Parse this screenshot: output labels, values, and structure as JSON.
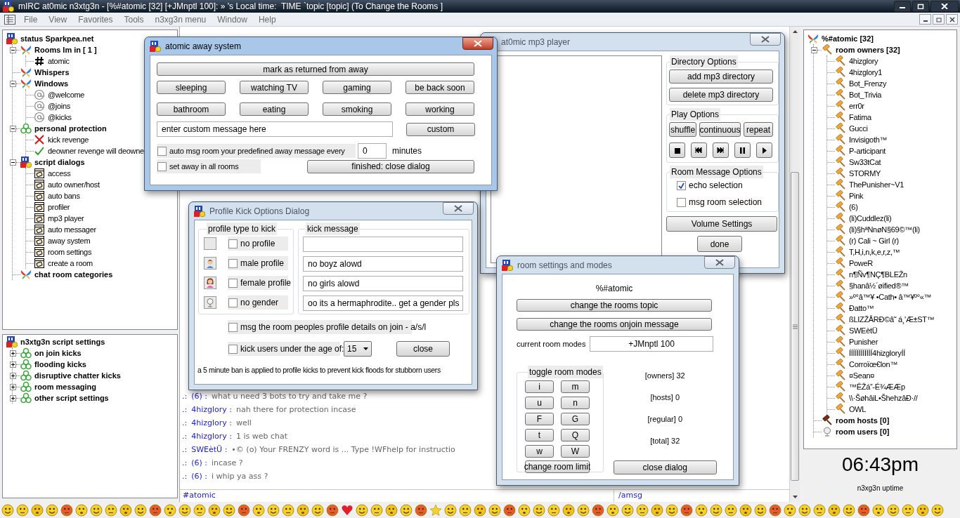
{
  "window": {
    "title": "mIRC at0mic n3xtg3n - [%#atomic [32] [+JMnptl 100]: » 's Local time:  TIME `topic [topic] (To Change the Rooms ]",
    "menu": [
      "File",
      "View",
      "Favorites",
      "Tools",
      "n3xg3n menu",
      "Window",
      "Help"
    ]
  },
  "server_tree": {
    "label": "status Sparkpea.net",
    "kind": "server",
    "children": [
      {
        "label": "Rooms Im in [ 1 ]",
        "kind": "butterfly",
        "expanded": true,
        "children": [
          {
            "label": "atomic",
            "kind": "channel"
          }
        ]
      },
      {
        "label": "Whispers",
        "kind": "butterfly"
      },
      {
        "label": "Windows",
        "kind": "butterfly",
        "expanded": true,
        "children": [
          {
            "label": "@welcome",
            "kind": "query"
          },
          {
            "label": "@joins",
            "kind": "query"
          },
          {
            "label": "@kicks",
            "kind": "query"
          }
        ]
      },
      {
        "label": "personal protection",
        "kind": "biohazard",
        "expanded": true,
        "children": [
          {
            "label": "kick revenge",
            "kind": "toggle",
            "enabled": false
          },
          {
            "label": "deowner revenge will deowne",
            "kind": "toggle",
            "enabled": true
          }
        ]
      },
      {
        "label": "script dialogs",
        "kind": "server",
        "expanded": true,
        "children": [
          {
            "label": "access",
            "kind": "dialog"
          },
          {
            "label": "auto owner/host",
            "kind": "dialog"
          },
          {
            "label": "auto bans",
            "kind": "dialog"
          },
          {
            "label": "profiler",
            "kind": "dialog"
          },
          {
            "label": "mp3 player",
            "kind": "dialog"
          },
          {
            "label": "auto messager",
            "kind": "dialog"
          },
          {
            "label": "away system",
            "kind": "dialog"
          },
          {
            "label": "room settings",
            "kind": "dialog"
          },
          {
            "label": "create a room",
            "kind": "dialog"
          }
        ]
      },
      {
        "label": "chat room categories",
        "kind": "butterfly"
      }
    ]
  },
  "settings_tree": {
    "label": "n3xtg3n script settings",
    "kind": "server",
    "children": [
      {
        "label": "on join kicks",
        "kind": "biohazard",
        "expanded": false
      },
      {
        "label": "flooding kicks",
        "kind": "biohazard",
        "expanded": false
      },
      {
        "label": "disruptive chatter kicks",
        "kind": "biohazard",
        "expanded": false
      },
      {
        "label": "room messaging",
        "kind": "biohazard",
        "expanded": false
      },
      {
        "label": "other script settings",
        "kind": "biohazard",
        "expanded": false
      }
    ]
  },
  "chat": {
    "lines": [
      {
        "prefix": ".:",
        "nick": "(6) :",
        "text": "what u need 3 bots to try and take me ?"
      },
      {
        "prefix": ".:",
        "nick": "4hizglory :",
        "text": "nah there for protection incase"
      },
      {
        "prefix": ".:",
        "nick": "4hizglory :",
        "text": "well"
      },
      {
        "prefix": ".:",
        "nick": "4hizglory :",
        "text": "1 is web chat"
      },
      {
        "prefix": ".:",
        "nick": "SWEètÜ :",
        "text": "•© (o) Your FRENZY word is ... Type !WFhelp for instructio"
      },
      {
        "prefix": ".:",
        "nick": "(6) :",
        "text": "incase ?"
      },
      {
        "prefix": ".:",
        "nick": "(6) :",
        "text": "i whip ya ass ?"
      }
    ],
    "input": "#atomic",
    "command": "/amsg"
  },
  "nicklist": {
    "label": "%#atomic [32]",
    "kind": "butterfly",
    "children": [
      {
        "label": "room owners [32]",
        "kind": "owner",
        "expanded": true,
        "children": [
          {
            "label": "4hizglory",
            "kind": "owner"
          },
          {
            "label": "4hizglory1",
            "kind": "owner"
          },
          {
            "label": "Bot_Frenzy",
            "kind": "owner"
          },
          {
            "label": "Bot_Trivia",
            "kind": "owner"
          },
          {
            "label": "err0r",
            "kind": "owner"
          },
          {
            "label": "Fatima",
            "kind": "owner"
          },
          {
            "label": "Gucci",
            "kind": "owner"
          },
          {
            "label": "Invisigoth™",
            "kind": "owner"
          },
          {
            "label": "P-articipant",
            "kind": "owner"
          },
          {
            "label": "Sw33tCat",
            "kind": "owner"
          },
          {
            "label": "STORMY",
            "kind": "owner"
          },
          {
            "label": "ThePunisher~V1",
            "kind": "owner"
          },
          {
            "label": "Pink",
            "kind": "owner"
          },
          {
            "label": "(6)",
            "kind": "owner"
          },
          {
            "label": "(li)Cuddlez(li)",
            "kind": "owner"
          },
          {
            "label": "(li)§hªNnøN§69©™(li)",
            "kind": "owner"
          },
          {
            "label": "(r) Cali ~ Girl (r)",
            "kind": "owner"
          },
          {
            "label": "T,H,i,n,k,e,r,z,™",
            "kind": "owner"
          },
          {
            "label": "PoweR",
            "kind": "owner"
          },
          {
            "label": "n¶Ñv¶NÇ¶BLEŽn",
            "kind": "owner"
          },
          {
            "label": "§hanâ½´øified®™",
            "kind": "owner"
          },
          {
            "label": "»º°â™¥ •Cath• â™¥º°«™",
            "kind": "owner"
          },
          {
            "label": "Ðatto™",
            "kind": "owner"
          },
          {
            "label": "ßLIZŽÅRÐ©â˜ á¸'Æ±ST™",
            "kind": "owner"
          },
          {
            "label": "SWEètÜ",
            "kind": "owner"
          },
          {
            "label": "Punisher",
            "kind": "owner"
          },
          {
            "label": "ÍÍÍÍÍÍÍÍÍÍÍÍ4hizgloryÍÍ",
            "kind": "owner"
          },
          {
            "label": "Corroïœ€lon™",
            "kind": "owner"
          },
          {
            "label": "¤Sean¤",
            "kind": "owner"
          },
          {
            "label": "™ÊŽá”-É¾ÆÆp",
            "kind": "owner"
          },
          {
            "label": "\\\\·ŠøhâiL•ŠhehzâÐ·//",
            "kind": "owner"
          },
          {
            "label": "OWL",
            "kind": "owner"
          }
        ]
      },
      {
        "label": "room hosts [0]",
        "kind": "host"
      },
      {
        "label": "room users [0]",
        "kind": "user"
      }
    ]
  },
  "clock": {
    "time": "06:43pm",
    "caption": "n3xg3n uptime"
  },
  "away_dialog": {
    "title": "atomic away system",
    "active": true,
    "return_button": "mark as returned from away",
    "status_buttons": [
      "sleeping",
      "watching TV",
      "gaming",
      "be back soon",
      "bathroom",
      "eating",
      "smoking",
      "working"
    ],
    "custom_message": "enter custom message here",
    "custom_button": "custom",
    "auto_msg": {
      "label": "auto msg room your predefined away message every",
      "checked": false
    },
    "minutes_value": "0",
    "minutes_label": "minutes",
    "all_rooms": {
      "label": "set away in all rooms",
      "checked": false
    },
    "close_button": "finished: close dialog"
  },
  "profile_dialog": {
    "title": "Profile Kick Options Dialog",
    "active": false,
    "type_group": "profile type to kick",
    "message_group": "kick message",
    "rows": [
      {
        "kind": "none",
        "label": "no profile",
        "checked": false
      },
      {
        "kind": "male",
        "label": "male profile",
        "checked": false,
        "message": "no boyz alowd"
      },
      {
        "kind": "female",
        "label": "female profile",
        "checked": false,
        "message": "no girls alowd"
      },
      {
        "kind": "nogender",
        "label": "no gender",
        "checked": false,
        "message": "oo its a hermaphrodite.. get a gender pls"
      }
    ],
    "join_msg": {
      "label": "msg the room peoples profile details on join - a/s/l",
      "checked": false
    },
    "age": {
      "label": "kick users under the age of:",
      "checked": false,
      "value": "15"
    },
    "close_button": "close",
    "note": "a 5 minute ban is applied to profile kicks to prevent kick floods for stubborn users"
  },
  "mp3_dialog": {
    "title": "at0mic mp3 player",
    "active": false,
    "directory_group": "Directory Options",
    "directory_buttons": [
      "add mp3 directory",
      "delete mp3 directory"
    ],
    "play_group": "Play Options",
    "mode_buttons": [
      "shuffle",
      "continuous",
      "repeat"
    ],
    "message_group": "Room Message Options",
    "message_options": [
      {
        "label": "echo selection",
        "checked": true
      },
      {
        "label": "msg room selection",
        "checked": false
      }
    ],
    "volume_button": "Volume Settings",
    "done_button": "done"
  },
  "room_dialog": {
    "title": "room settings and modes",
    "active": false,
    "channel": "%#atomic",
    "buttons": [
      "change the rooms topic",
      "change the rooms onjoin message"
    ],
    "modes_label": "current room modes",
    "modes_value": "+JMnptl 100",
    "toggle_group": "toggle room modes",
    "mode_buttons": [
      "i",
      "m",
      "u",
      "n",
      "F",
      "G",
      "t",
      "Q",
      "w",
      "W"
    ],
    "limit_button": "change room limit",
    "stats": [
      "[owners] 32",
      "[hosts] 0",
      "[regular] 0",
      "[total] 32"
    ],
    "close_button": "close dialog"
  }
}
